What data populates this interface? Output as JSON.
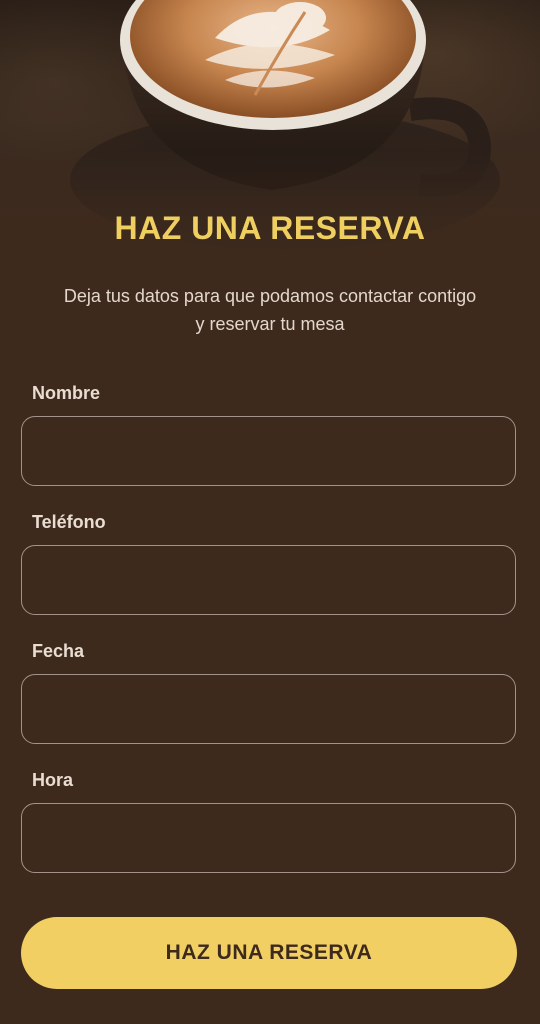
{
  "hero": {
    "image_subject": "latte-art-coffee-cup"
  },
  "title": "HAZ UNA RESERVA",
  "subtitle": "Deja tus datos para que podamos contactar contigo y reservar tu mesa",
  "form": {
    "fields": [
      {
        "label": "Nombre",
        "value": ""
      },
      {
        "label": "Teléfono",
        "value": ""
      },
      {
        "label": "Fecha",
        "value": ""
      },
      {
        "label": "Hora",
        "value": ""
      }
    ],
    "submit_label": "HAZ UNA RESERVA"
  },
  "colors": {
    "background": "#3e2a1d",
    "accent": "#f2cf63",
    "title": "#f0cf61",
    "input_border": "#a2928a",
    "text_light": "#e3d7cc"
  }
}
